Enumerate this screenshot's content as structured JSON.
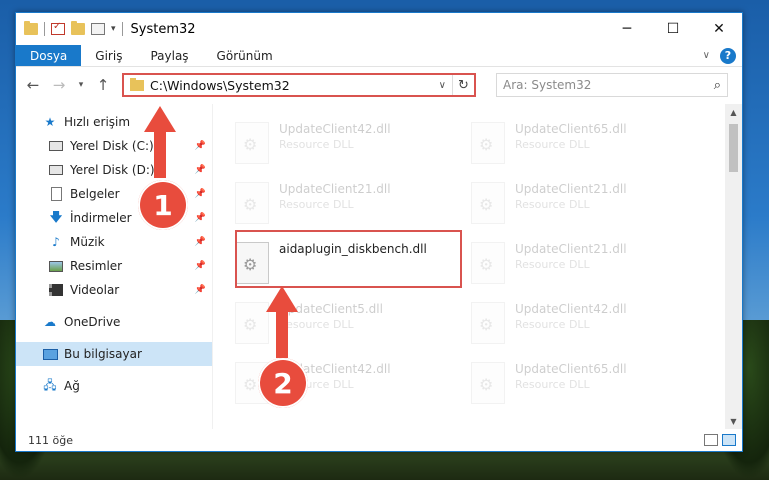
{
  "window": {
    "title": "System32",
    "controls": {
      "minimize": "─",
      "maximize": "☐",
      "close": "✕"
    }
  },
  "ribbon": {
    "tabs": [
      "Dosya",
      "Giriş",
      "Paylaş",
      "Görünüm"
    ],
    "help": "?"
  },
  "navbar": {
    "address": "C:\\Windows\\System32",
    "search_placeholder": "Ara: System32"
  },
  "sidebar": {
    "items": [
      {
        "label": "Hızlı erişim"
      },
      {
        "label": "Yerel Disk (C:)"
      },
      {
        "label": "Yerel Disk (D:)"
      },
      {
        "label": "Belgeler"
      },
      {
        "label": "İndirmeler"
      },
      {
        "label": "Müzik"
      },
      {
        "label": "Resimler"
      },
      {
        "label": "Videolar"
      },
      {
        "label": "OneDrive"
      },
      {
        "label": "Bu bilgisayar"
      },
      {
        "label": "Ağ"
      }
    ]
  },
  "files": [
    {
      "name": "UpdateClient42.dll",
      "type": "Resource DLL"
    },
    {
      "name": "UpdateClient65.dll",
      "type": "Resource DLL"
    },
    {
      "name": "UpdateClient21.dll",
      "type": "Resource DLL"
    },
    {
      "name": "UpdateClient21.dll",
      "type": "Resource DLL"
    },
    {
      "name": "aidaplugin_diskbench.dll",
      "type": ""
    },
    {
      "name": "UpdateClient21.dll",
      "type": "Resource DLL"
    },
    {
      "name": "UpdateClient5.dll",
      "type": "Resource DLL"
    },
    {
      "name": "UpdateClient42.dll",
      "type": "Resource DLL"
    },
    {
      "name": "UpdateClient42.dll",
      "type": "Resource DLL"
    },
    {
      "name": "UpdateClient65.dll",
      "type": "Resource DLL"
    }
  ],
  "status": {
    "item_count": "111 öğe"
  },
  "callouts": {
    "one": "1",
    "two": "2"
  },
  "colors": {
    "accent": "#1979ca",
    "highlight": "#d9534f",
    "callout": "#e84c3d"
  }
}
